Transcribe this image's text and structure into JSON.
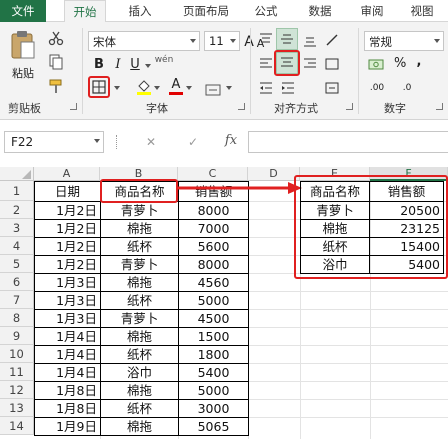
{
  "tabs": [
    "文件",
    "开始",
    "插入",
    "页面布局",
    "公式",
    "数据",
    "审阅",
    "视图"
  ],
  "active_tab": "开始",
  "ribbon": {
    "paste_label": "粘贴",
    "clipboard_label": "剪贴板",
    "font_name": "宋体",
    "font_size": "11",
    "font_group_label": "字体",
    "bold": "B",
    "italic": "I",
    "underline": "U",
    "grow_font": "A",
    "shrink_font": "A",
    "wen": "wén",
    "font_color_letter": "A",
    "align_group_label": "对齐方式",
    "number_format": "常规",
    "number_group_label": "数字",
    "percent": "%",
    "comma": ",",
    "dec_inc": ".00",
    "dec_dec": ".0"
  },
  "formula_bar": {
    "name_box": "F22",
    "cancel": "✕",
    "enter": "✓",
    "fx": "fx",
    "formula": ""
  },
  "sheet": {
    "columns": [
      "A",
      "B",
      "C",
      "D",
      "E",
      "F"
    ],
    "rows": [
      "1",
      "2",
      "3",
      "4",
      "5",
      "6",
      "7",
      "8",
      "9",
      "10",
      "11",
      "12",
      "13",
      "14"
    ],
    "header": [
      "日期",
      "商品名称",
      "销售额"
    ],
    "data": [
      [
        "1月2日",
        "青萝卜",
        "8000"
      ],
      [
        "1月2日",
        "棉拖",
        "7000"
      ],
      [
        "1月2日",
        "纸杯",
        "5600"
      ],
      [
        "1月2日",
        "青萝卜",
        "8000"
      ],
      [
        "1月3日",
        "棉拖",
        "4560"
      ],
      [
        "1月3日",
        "纸杯",
        "5000"
      ],
      [
        "1月3日",
        "青萝卜",
        "4500"
      ],
      [
        "1月4日",
        "棉拖",
        "1500"
      ],
      [
        "1月4日",
        "纸杯",
        "1800"
      ],
      [
        "1月4日",
        "浴巾",
        "5400"
      ],
      [
        "1月8日",
        "棉拖",
        "5000"
      ],
      [
        "1月8日",
        "纸杯",
        "3000"
      ],
      [
        "1月9日",
        "棉拖",
        "5065"
      ]
    ],
    "summary_header": [
      "商品名称",
      "销售额"
    ],
    "summary": [
      [
        "青萝卜",
        "20500"
      ],
      [
        "棉拖",
        "23125"
      ],
      [
        "纸杯",
        "15400"
      ],
      [
        "浴巾",
        "5400"
      ]
    ]
  },
  "colors": {
    "excel_green": "#217346",
    "annotation_red": "#e02020"
  }
}
